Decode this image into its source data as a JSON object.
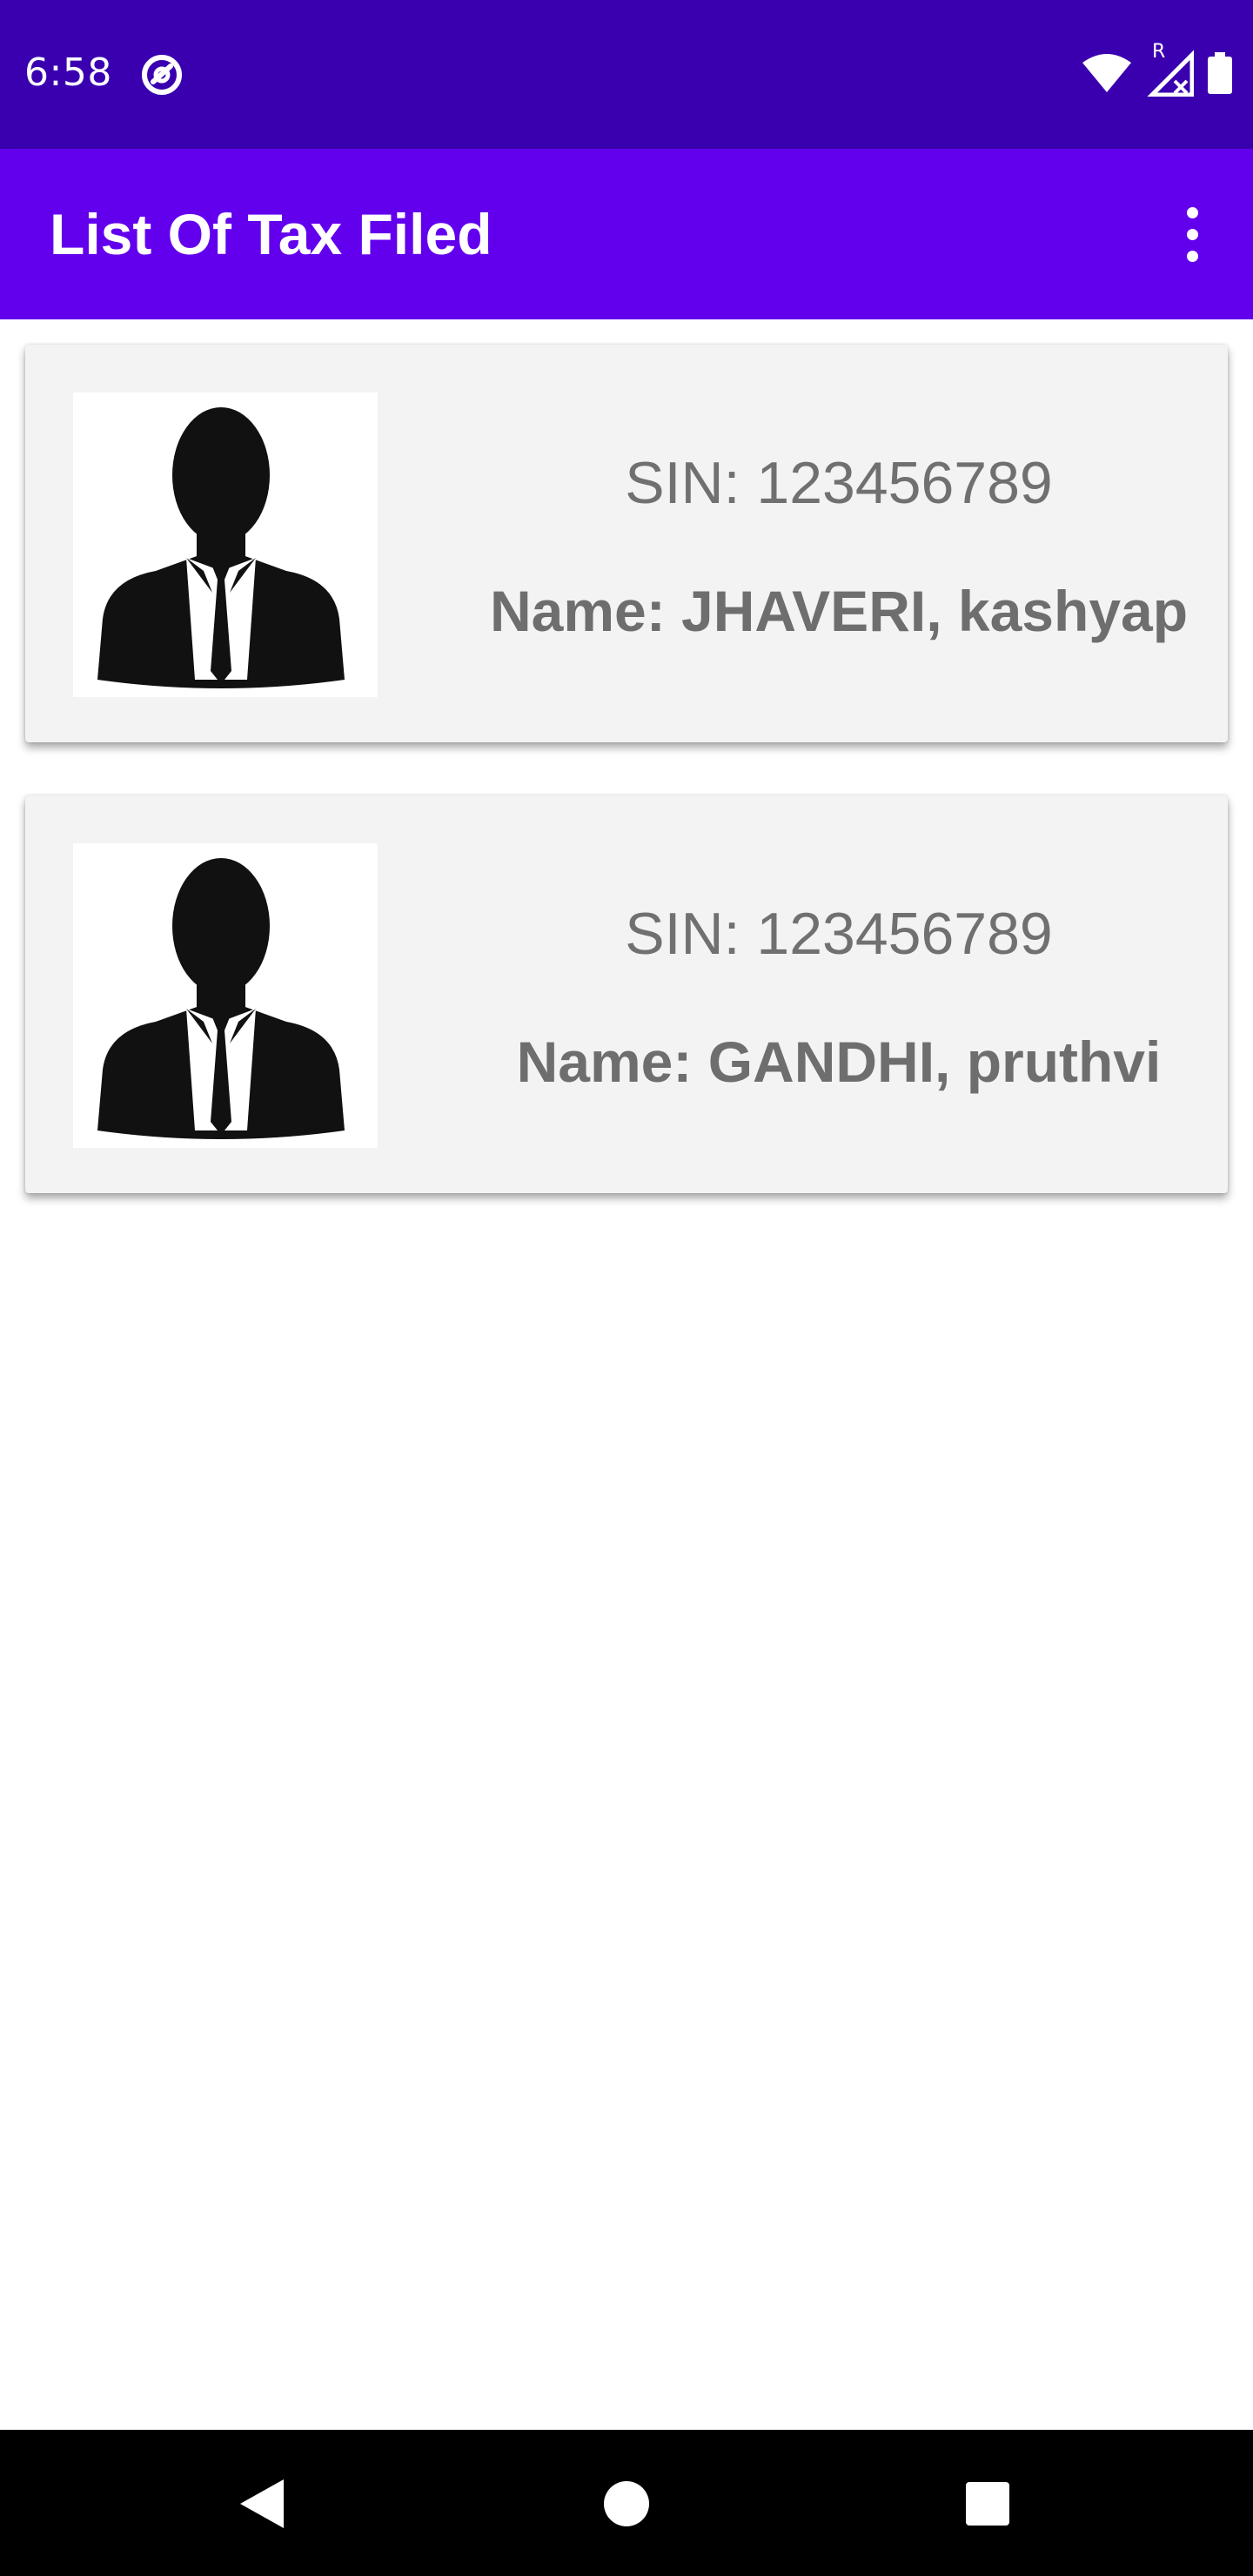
{
  "status_bar": {
    "time": "6:58",
    "icons": [
      "app-notification-icon",
      "wifi-icon",
      "signal-roaming-icon",
      "battery-icon"
    ],
    "roaming_label": "R",
    "background": "#3a00b0"
  },
  "app_bar": {
    "title": "List Of Tax Filed",
    "overflow_icon": "more-vert-icon",
    "background": "#6200ee"
  },
  "records": [
    {
      "sin": "SIN: 123456789",
      "name": "Name: JHAVERI, kashyap",
      "avatar": "person-silhouette-icon"
    },
    {
      "sin": "SIN: 123456789",
      "name": "Name: GANDHI, pruthvi",
      "avatar": "person-silhouette-icon"
    }
  ],
  "nav_bar": {
    "icons": [
      "back-icon",
      "home-icon",
      "recents-icon"
    ]
  }
}
